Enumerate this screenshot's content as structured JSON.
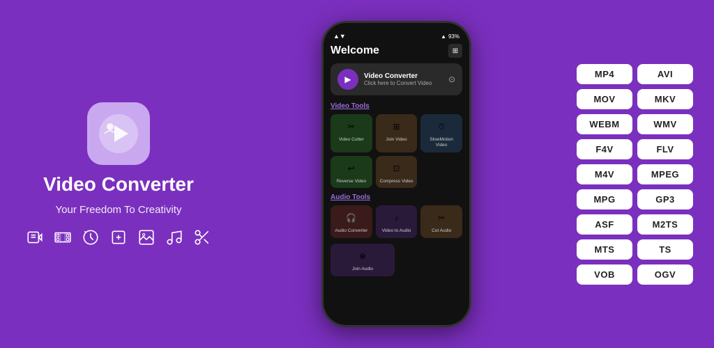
{
  "app": {
    "title": "Video Converter",
    "subtitle": "Your Freedom To Creativity",
    "icon_label": "app-logo"
  },
  "phone": {
    "status": {
      "signal": "▲▼",
      "wifi": "WiFi",
      "battery": "93%"
    },
    "header": {
      "title": "Welcome"
    },
    "banner": {
      "title": "Video Converter",
      "subtitle": "Click here to Convert Video"
    },
    "video_tools": {
      "section_title": "Video Tools",
      "items": [
        {
          "label": "Video Cutter",
          "color": "icon-green"
        },
        {
          "label": "Join Video",
          "color": "icon-brown"
        },
        {
          "label": "SlowMotion Video",
          "color": "icon-blue"
        },
        {
          "label": "Reverse Video",
          "color": "icon-green"
        },
        {
          "label": "Compress Video",
          "color": "icon-brown"
        }
      ]
    },
    "audio_tools": {
      "section_title": "Audio Tools",
      "items": [
        {
          "label": "Audio Converter",
          "color": "icon-red"
        },
        {
          "label": "Video to Audio",
          "color": "icon-purple"
        },
        {
          "label": "Cut Audio",
          "color": "icon-brown"
        },
        {
          "label": "Join Audio",
          "color": "icon-purple"
        }
      ]
    }
  },
  "formats": [
    "MP4",
    "AVI",
    "MOV",
    "MKV",
    "WEBM",
    "WMV",
    "F4V",
    "FLV",
    "M4V",
    "MPEG",
    "MPG",
    "GP3",
    "ASF",
    "M2TS",
    "MTS",
    "TS",
    "VOB",
    "OGV"
  ],
  "icon_row": [
    "video-tools-icon",
    "film-strip-icon",
    "slow-motion-icon",
    "compress-icon",
    "image-tools-icon",
    "music-note-icon",
    "scissors-icon"
  ]
}
